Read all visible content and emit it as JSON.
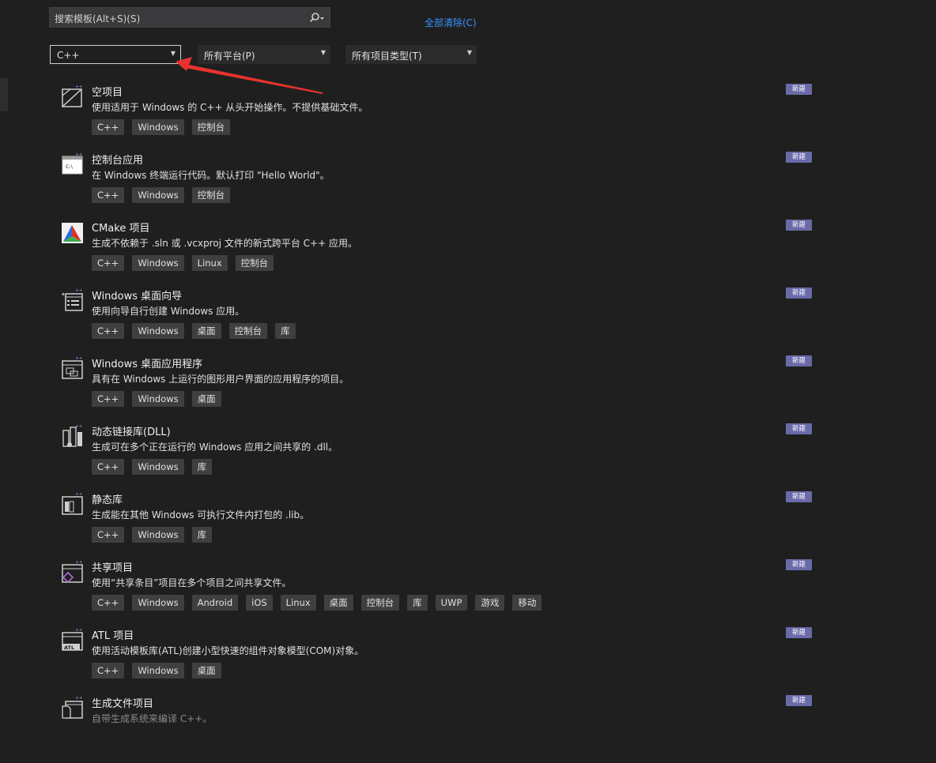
{
  "search": {
    "placeholder": "搜索模板(Alt+S)(S)"
  },
  "clear_all": "全部清除(C)",
  "filters": {
    "language": "C++",
    "platform": "所有平台(P)",
    "project_type": "所有项目类型(T)"
  },
  "badge_label": "新建",
  "templates": [
    {
      "title": "空项目",
      "description": "使用适用于 Windows 的 C++ 从头开始操作。不提供基础文件。",
      "tags": [
        "C++",
        "Windows",
        "控制台"
      ]
    },
    {
      "title": "控制台应用",
      "description": "在 Windows 终端运行代码。默认打印 \"Hello World\"。",
      "tags": [
        "C++",
        "Windows",
        "控制台"
      ]
    },
    {
      "title": "CMake 项目",
      "description": "生成不依赖于 .sln 或 .vcxproj 文件的新式跨平台 C++ 应用。",
      "tags": [
        "C++",
        "Windows",
        "Linux",
        "控制台"
      ]
    },
    {
      "title": "Windows 桌面向导",
      "description": "使用向导自行创建 Windows 应用。",
      "tags": [
        "C++",
        "Windows",
        "桌面",
        "控制台",
        "库"
      ]
    },
    {
      "title": "Windows 桌面应用程序",
      "description": "具有在 Windows 上运行的图形用户界面的应用程序的项目。",
      "tags": [
        "C++",
        "Windows",
        "桌面"
      ]
    },
    {
      "title": "动态链接库(DLL)",
      "description": "生成可在多个正在运行的 Windows 应用之间共享的 .dll。",
      "tags": [
        "C++",
        "Windows",
        "库"
      ]
    },
    {
      "title": "静态库",
      "description": "生成能在其他 Windows 可执行文件内打包的 .lib。",
      "tags": [
        "C++",
        "Windows",
        "库"
      ]
    },
    {
      "title": "共享项目",
      "description": "使用“共享条目”项目在多个项目之间共享文件。",
      "tags": [
        "C++",
        "Windows",
        "Android",
        "iOS",
        "Linux",
        "桌面",
        "控制台",
        "库",
        "UWP",
        "游戏",
        "移动"
      ]
    },
    {
      "title": "ATL 项目",
      "description": "使用活动模板库(ATL)创建小型快速的组件对象模型(COM)对象。",
      "tags": [
        "C++",
        "Windows",
        "桌面"
      ]
    },
    {
      "title": "生成文件项目",
      "description": "自带生成系统来编译 C++。",
      "tags": []
    }
  ],
  "icons": [
    "empty-project-icon",
    "console-app-icon",
    "cmake-icon",
    "desktop-wizard-icon",
    "desktop-app-icon",
    "dll-icon",
    "static-lib-icon",
    "shared-project-icon",
    "atl-icon",
    "makefile-icon"
  ],
  "icon_text": {
    "console": "C:\\",
    "atl": "ATL"
  },
  "colors": {
    "background": "#1f1f1f",
    "accent": "#3794ff",
    "badge": "#6a6aa8",
    "tag": "#3f3f41",
    "arrow": "#e8322e"
  }
}
